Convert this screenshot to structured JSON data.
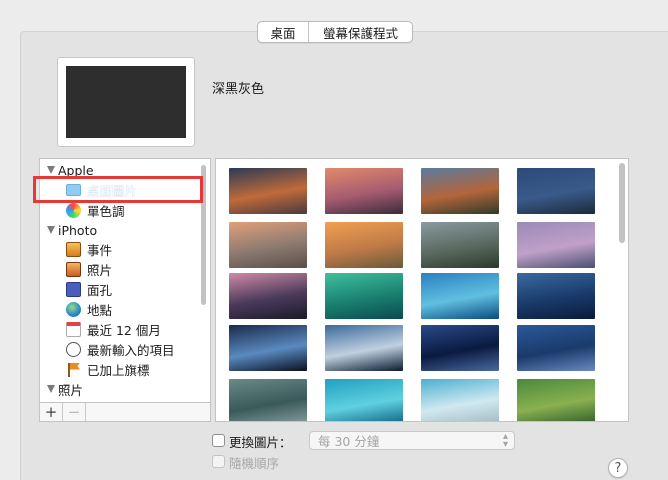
{
  "tabs": [
    {
      "label": "桌面",
      "selected": true
    },
    {
      "label": "螢幕保護程式",
      "selected": false
    }
  ],
  "current_wallpaper": {
    "name": "深黑灰色"
  },
  "source_list": {
    "groups": [
      {
        "label": "Apple",
        "items": [
          {
            "label": "桌面圖片",
            "icon": "folder-icon",
            "selected": true
          },
          {
            "label": "單色調",
            "icon": "color-wheel-icon"
          }
        ]
      },
      {
        "label": "iPhoto",
        "items": [
          {
            "label": "事件",
            "icon": "events-icon"
          },
          {
            "label": "照片",
            "icon": "photos-icon"
          },
          {
            "label": "面孔",
            "icon": "faces-icon"
          },
          {
            "label": "地點",
            "icon": "globe-icon"
          },
          {
            "label": "最近 12 個月",
            "icon": "calendar-icon"
          },
          {
            "label": "最新輸入的項目",
            "icon": "import-icon"
          },
          {
            "label": "已加上旗標",
            "icon": "flag-icon"
          }
        ]
      },
      {
        "label": "照片",
        "items": []
      }
    ],
    "footer": {
      "add": "+",
      "remove": "−"
    }
  },
  "thumbnails": [
    {
      "colors": [
        "#2b3a55",
        "#c06a3a",
        "#4a3a40"
      ]
    },
    {
      "colors": [
        "#e28a6a",
        "#a65b70",
        "#3a2c3c"
      ]
    },
    {
      "colors": [
        "#5a7aa0",
        "#b4653a",
        "#2e3a2a"
      ]
    },
    {
      "colors": [
        "#2a4a7a",
        "#3a5a8a",
        "#1c2a3a"
      ]
    },
    {
      "colors": [
        "#e0a07a",
        "#8c7a70",
        "#5a5048"
      ]
    },
    {
      "colors": [
        "#f0a050",
        "#c07a48",
        "#6a5a3a"
      ]
    },
    {
      "colors": [
        "#8a9aa0",
        "#5a6a60",
        "#2a3a2a"
      ]
    },
    {
      "colors": [
        "#9a8ab8",
        "#c0a0c8",
        "#4a5070"
      ]
    },
    {
      "colors": [
        "#d08aa8",
        "#4a3a5a",
        "#1a1a2a"
      ]
    },
    {
      "colors": [
        "#40c0a0",
        "#1a8070",
        "#0a4a50"
      ]
    },
    {
      "colors": [
        "#2a80c0",
        "#60c0e0",
        "#0a4a80"
      ]
    },
    {
      "colors": [
        "#3a6aa0",
        "#1a3a6a",
        "#0a1a3a"
      ]
    },
    {
      "colors": [
        "#1a2a4a",
        "#5a8ac0",
        "#0a1020"
      ]
    },
    {
      "colors": [
        "#3a6a9a",
        "#c0d0e0",
        "#0a1a30"
      ]
    },
    {
      "colors": [
        "#2a4a8a",
        "#0a1a40",
        "#4a6aa0"
      ]
    },
    {
      "colors": [
        "#2a5a9a",
        "#1a3a6a",
        "#6a8ac0"
      ]
    },
    {
      "colors": [
        "#6a8a8a",
        "#3a5a5a",
        "#8aa0a0"
      ]
    },
    {
      "colors": [
        "#20a0c0",
        "#60d0e0",
        "#0a6080"
      ]
    },
    {
      "colors": [
        "#4ab0d0",
        "#d0e8f0",
        "#a0b8c0"
      ]
    },
    {
      "colors": [
        "#4a8a3a",
        "#8ab050",
        "#2a5a2a"
      ]
    }
  ],
  "change_picture": {
    "label": "更換圖片：",
    "interval": "每 30 分鐘"
  },
  "random_order": {
    "label": "隨機順序"
  },
  "help": "?"
}
